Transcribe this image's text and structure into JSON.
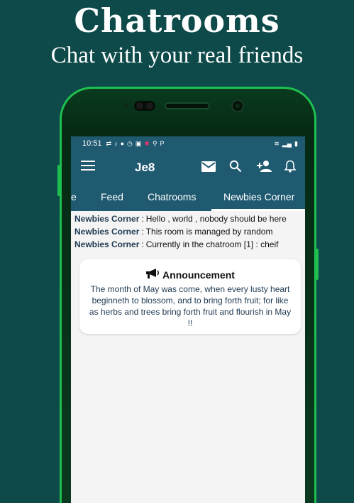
{
  "promo": {
    "title": "Chatrooms",
    "subtitle": "Chat with your real friends"
  },
  "status_bar": {
    "time": "10:51"
  },
  "app_bar": {
    "title": "Je8",
    "icons": [
      "menu-icon",
      "mail-icon",
      "search-icon",
      "add-user-icon",
      "bell-icon"
    ]
  },
  "tabs": [
    {
      "label": "e"
    },
    {
      "label": "Feed"
    },
    {
      "label": "Chatrooms"
    },
    {
      "label": "Newbies Corner",
      "selected": true
    }
  ],
  "messages": [
    {
      "user": "Newbies Corner",
      "sep": ":",
      "text": "Hello , world , nobody should be here"
    },
    {
      "user": "Newbies Corner",
      "sep": ":",
      "text": "This room is managed by random"
    },
    {
      "user": "Newbies Corner",
      "sep": ":",
      "text": "Currently in the chatroom [1] : cheif"
    }
  ],
  "announcement": {
    "title": "Announcement",
    "body": "The month of May was come, when every lusty heart beginneth to blossom, and to bring forth fruit; for like as herbs and trees bring forth fruit and flourish in May !!"
  },
  "colors": {
    "background": "#0e4a4a",
    "app_bar": "#1f5a71",
    "phone_frame": "#1fbf4f"
  }
}
